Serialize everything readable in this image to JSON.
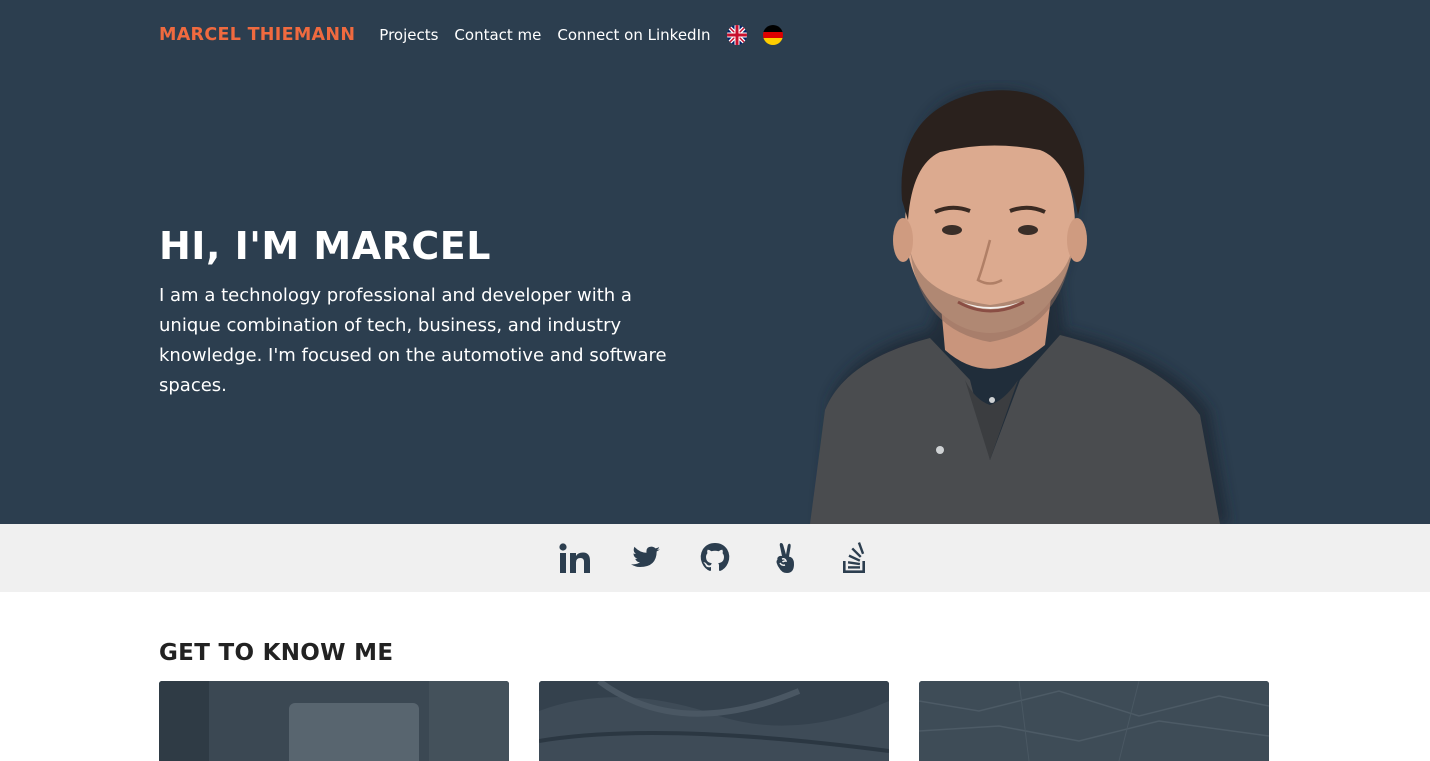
{
  "nav": {
    "brand": "MARCEL THIEMANN",
    "links": [
      "Projects",
      "Contact me",
      "Connect on LinkedIn"
    ],
    "languages": [
      "english-flag-icon",
      "german-flag-icon"
    ]
  },
  "hero": {
    "title": "HI, I'M MARCEL",
    "description": "I am a technology professional and developer with a unique combination of tech, business, and industry knowledge. I'm focused on the automotive and software spaces."
  },
  "social": {
    "icons": [
      "linkedin-icon",
      "twitter-icon",
      "github-icon",
      "angellist-icon",
      "stackoverflow-icon"
    ]
  },
  "about": {
    "title": "GET TO KNOW ME"
  },
  "colors": {
    "hero_bg": "#2c3e4f",
    "brand": "#f06a3f",
    "social_bar_bg": "#f0f0f0",
    "icon_color": "#2c3e4f"
  }
}
